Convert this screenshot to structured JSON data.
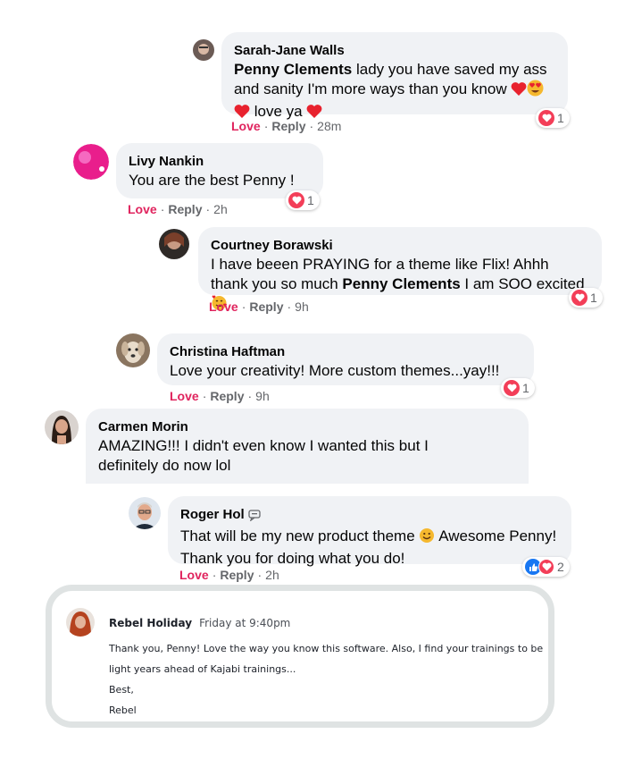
{
  "comments": [
    {
      "author": "Sarah-Jane Walls",
      "mention": "Penny Clements",
      "text_part1": " lady you have saved my ass and sanity I'm more ways than you know ",
      "text_part2": " love ya ",
      "love": "Love",
      "reply": "Reply",
      "time": "28m",
      "reaction_count": "1"
    },
    {
      "author": "Livy Nankin",
      "text": "You are the best Penny !",
      "love": "Love",
      "reply": "Reply",
      "time": "2h",
      "reaction_count": "1"
    },
    {
      "author": "Courtney Borawski",
      "text_part1": "I have beeen PRAYING for a theme like Flix! Ahhh thank you so much ",
      "mention": "Penny Clements",
      "text_part2": " I am SOO excited ",
      "love": "Love",
      "reply": "Reply",
      "time": "9h",
      "reaction_count": "1"
    },
    {
      "author": "Christina Haftman",
      "text": "Love your creativity! More custom themes...yay!!!",
      "love": "Love",
      "reply": "Reply",
      "time": "9h",
      "reaction_count": "1"
    },
    {
      "author": "Carmen Morin",
      "text": "AMAZING!!! I didn't even know I wanted this but I definitely do now lol"
    },
    {
      "author": "Roger Hol",
      "text_part1": "That will be my new product theme ",
      "text_part2": " Awesome Penny! Thank you for doing what you do!",
      "love": "Love",
      "reply": "Reply",
      "time": "2h",
      "reaction_count": "2"
    }
  ],
  "highlight": {
    "author": "Rebel Holiday",
    "time": "Friday at 9:40pm",
    "line1": "Thank you, Penny! Love the way you know this software. Also, I find your trainings to be",
    "line2": "light years ahead of Kajabi trainings...",
    "line3": "Best,",
    "line4": "Rebel"
  },
  "separator": "·",
  "icons": [
    "heart-emoji",
    "heart-eyes-emoji",
    "smiling-face-with-hearts-emoji",
    "smile-emoji",
    "like-reaction-icon",
    "love-reaction-icon",
    "messenger-icon"
  ],
  "colors": {
    "bubble": "#f0f2f5",
    "love_action": "#e0245e",
    "heart_reaction": "#f33e58",
    "like_reaction": "#1877f2"
  }
}
